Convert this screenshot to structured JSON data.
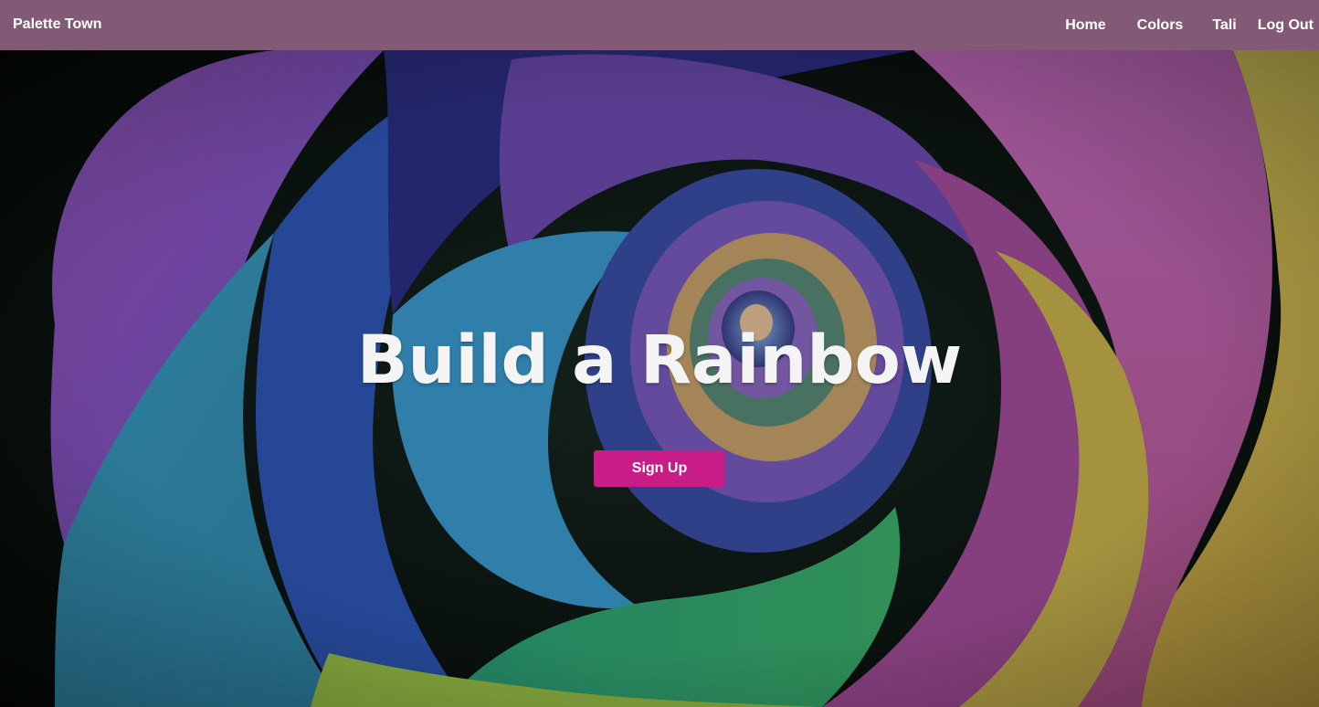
{
  "navbar": {
    "brand": "Palette Town",
    "links": [
      {
        "label": "Home"
      },
      {
        "label": "Colors"
      },
      {
        "label": "Tali"
      },
      {
        "label": "Log Out"
      }
    ]
  },
  "hero": {
    "title": "Build a Rainbow",
    "cta_label": "Sign Up",
    "image_subject": "rainbow rose petals"
  },
  "colors": {
    "navbar_bg": "#825a75",
    "cta_bg": "#c81c86",
    "text": "#ffffff"
  }
}
